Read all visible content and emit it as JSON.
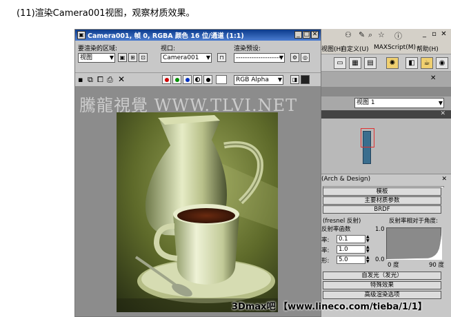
{
  "caption": "(11)渲染Camera001视图，观察材质效果。",
  "render_window": {
    "title": "Camera001, 帧 0, RGBA 颜色 16 位/通道 (1:1)",
    "area_label": "要渲染的区域:",
    "area_value": "视图",
    "viewport_label": "视口:",
    "viewport_value": "Camera001",
    "preset_label": "渲染预设:",
    "preset_value": "--------------------",
    "channel_value": "RGB Alpha",
    "watermark": "騰龍視覺 WWW.TLVI.NET"
  },
  "max": {
    "menu": [
      "视图(H)",
      "自定义(U)",
      "MAXScript(M)",
      "帮助(H)"
    ],
    "viewport_select": "视图 1"
  },
  "material": {
    "header": "(Arch & Design)",
    "rollouts": [
      "模板",
      "主要材质参数",
      "BRDF"
    ],
    "fresnel_label": "(fresnel 反射)",
    "curve_label": "反射率相对于角度:",
    "func_label": "反射率函数",
    "rows": [
      {
        "label": "率:",
        "value": "0.1"
      },
      {
        "label": "率:",
        "value": "1.0"
      },
      {
        "label": "形:",
        "value": "5.0"
      }
    ],
    "curve_top": "1.0",
    "curve_bottom": "0.0",
    "axis_left": "0 度",
    "axis_right": "90 度",
    "rollouts_bottom": [
      "自发光（发光）",
      "特殊效果",
      "高级渲染选项"
    ]
  },
  "footer": "3Dmax吧 【www.lineco.com/tieba/1/1】"
}
